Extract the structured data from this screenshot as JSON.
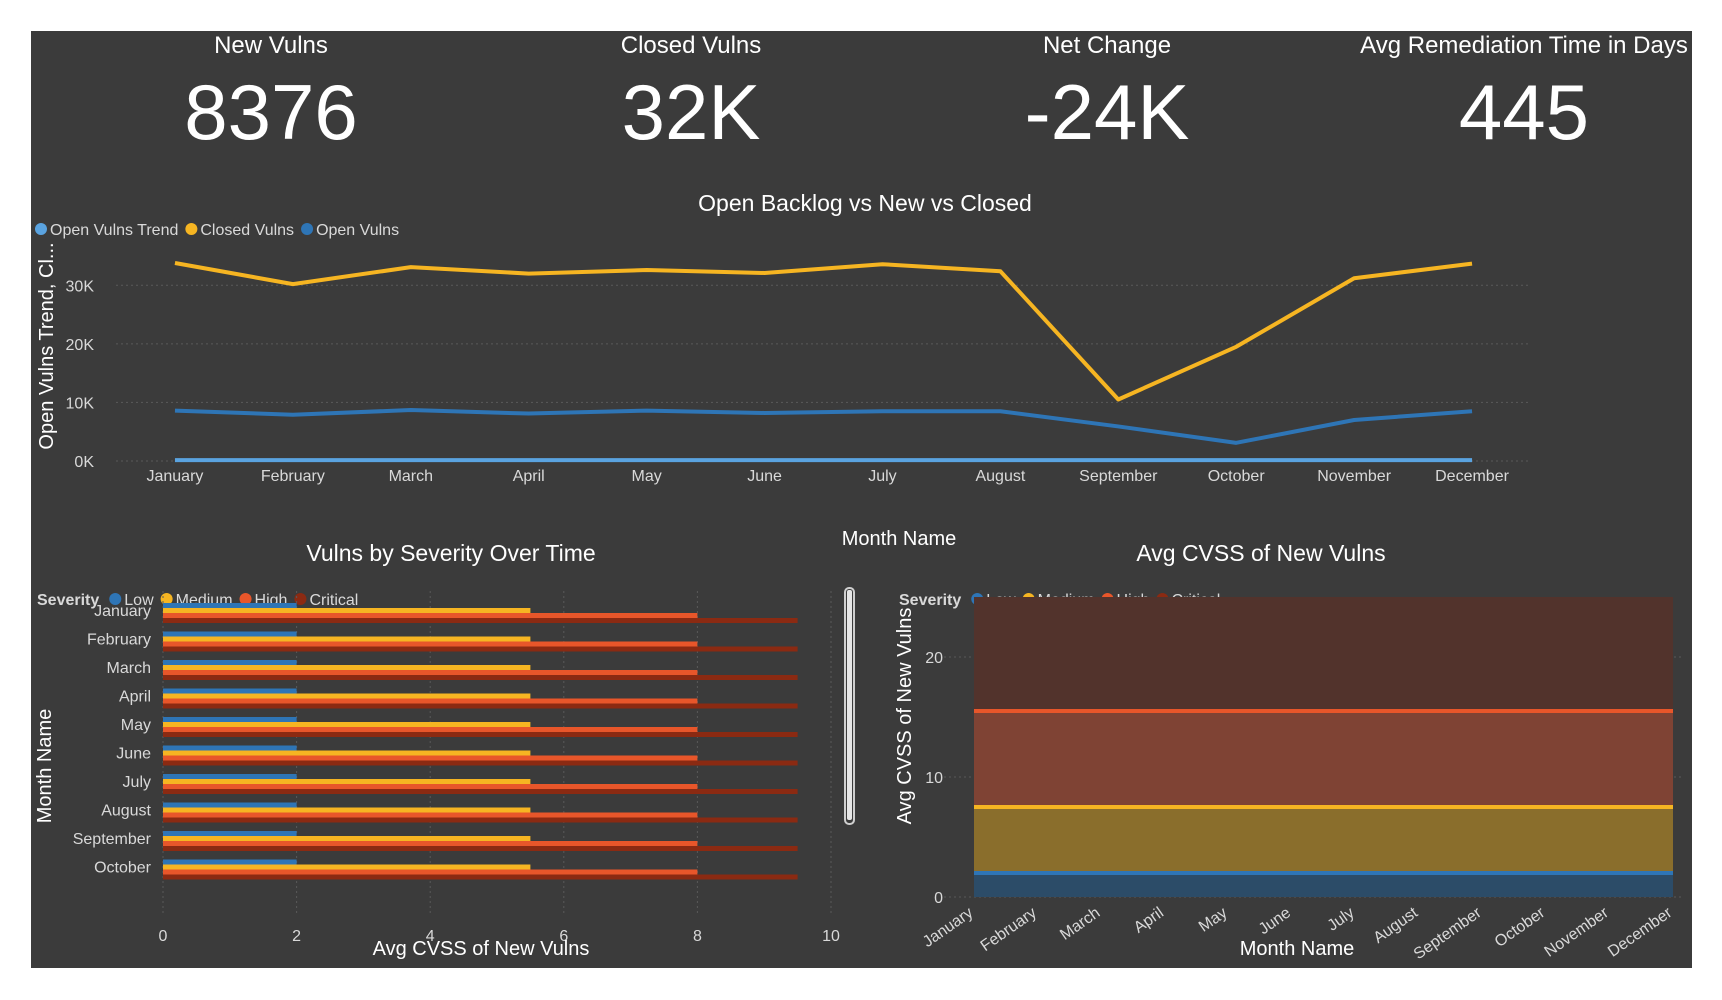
{
  "kpis": [
    {
      "label": "New Vulns",
      "value": "8376"
    },
    {
      "label": "Closed Vulns",
      "value": "32K"
    },
    {
      "label": "Net Change",
      "value": "-24K"
    },
    {
      "label": "Avg Remediation Time in Days",
      "value": "445"
    }
  ],
  "colors": {
    "background": "#3b3b3b",
    "open_trend": "#5aa3e0",
    "closed": "#f6b522",
    "open": "#2e75b6",
    "low": "#2e75b6",
    "medium": "#f6b522",
    "high": "#e8562a",
    "critical": "#8b2a12"
  },
  "legend_severity": {
    "title": "Severity",
    "items": [
      "Low",
      "Medium",
      "High",
      "Critical"
    ]
  },
  "chart_data": [
    {
      "type": "line",
      "title": "Open Backlog vs New vs Closed",
      "xlabel": "Month Name",
      "ylabel": "Open Vulns Trend, Cl...",
      "legend": [
        "Open Vulns Trend",
        "Closed Vulns",
        "Open Vulns"
      ],
      "legend_position": "top-left",
      "categories": [
        "January",
        "February",
        "March",
        "April",
        "May",
        "June",
        "July",
        "August",
        "September",
        "October",
        "November",
        "December"
      ],
      "yticks": [
        "0K",
        "10K",
        "20K",
        "30K"
      ],
      "ylim": [
        0,
        35000
      ],
      "series": [
        {
          "name": "Open Vulns Trend",
          "values": [
            150,
            150,
            150,
            150,
            150,
            150,
            150,
            150,
            150,
            150,
            150,
            150
          ]
        },
        {
          "name": "Closed Vulns",
          "values": [
            33800,
            30200,
            33100,
            32000,
            32600,
            32100,
            33600,
            32400,
            10500,
            19500,
            31200,
            33700
          ]
        },
        {
          "name": "Open Vulns",
          "values": [
            8600,
            7900,
            8700,
            8100,
            8600,
            8200,
            8500,
            8500,
            5900,
            3100,
            7000,
            8500
          ]
        }
      ],
      "grid": true
    },
    {
      "type": "bar",
      "orientation": "horizontal",
      "title": "Vulns by Severity Over Time",
      "xlabel": "Avg CVSS of New Vulns",
      "ylabel": "Month Name",
      "legend_title": "Severity",
      "legend": [
        "Low",
        "Medium",
        "High",
        "Critical"
      ],
      "categories": [
        "January",
        "February",
        "March",
        "April",
        "May",
        "June",
        "July",
        "August",
        "September",
        "October"
      ],
      "xticks": [
        "0",
        "2",
        "4",
        "6",
        "8",
        "10"
      ],
      "xlim": [
        0,
        10
      ],
      "series": [
        {
          "name": "Low",
          "values": [
            2,
            2,
            2,
            2,
            2,
            2,
            2,
            2,
            2,
            2
          ]
        },
        {
          "name": "Medium",
          "values": [
            5.5,
            5.5,
            5.5,
            5.5,
            5.5,
            5.5,
            5.5,
            5.5,
            5.5,
            5.5
          ]
        },
        {
          "name": "High",
          "values": [
            8,
            8,
            8,
            8,
            8,
            8,
            8,
            8,
            8,
            8
          ]
        },
        {
          "name": "Critical",
          "values": [
            9.5,
            9.5,
            9.5,
            9.5,
            9.5,
            9.5,
            9.5,
            9.5,
            9.5,
            9.5
          ]
        }
      ],
      "grid": true
    },
    {
      "type": "area",
      "stacked": true,
      "title": "Avg CVSS of New Vulns",
      "xlabel": "Month Name",
      "ylabel": "Avg CVSS of New Vulns",
      "legend_title": "Severity",
      "legend": [
        "Low",
        "Medium",
        "High",
        "Critical"
      ],
      "categories": [
        "January",
        "February",
        "March",
        "April",
        "May",
        "June",
        "July",
        "August",
        "September",
        "October",
        "November",
        "December"
      ],
      "yticks": [
        "0",
        "10",
        "20"
      ],
      "ylim": [
        0,
        25
      ],
      "series": [
        {
          "name": "Low",
          "values": [
            2,
            2,
            2,
            2,
            2,
            2,
            2,
            2,
            2,
            2,
            2,
            2
          ]
        },
        {
          "name": "Medium",
          "values": [
            5.5,
            5.5,
            5.5,
            5.5,
            5.5,
            5.5,
            5.5,
            5.5,
            5.5,
            5.5,
            5.5,
            5.5
          ]
        },
        {
          "name": "High",
          "values": [
            8,
            8,
            8,
            8,
            8,
            8,
            8,
            8,
            8,
            8,
            8,
            8
          ]
        },
        {
          "name": "Critical",
          "values": [
            9.5,
            9.5,
            9.5,
            9.5,
            9.5,
            9.5,
            9.5,
            9.5,
            9.5,
            9.5,
            9.5,
            9.5
          ]
        }
      ],
      "grid": true
    }
  ]
}
